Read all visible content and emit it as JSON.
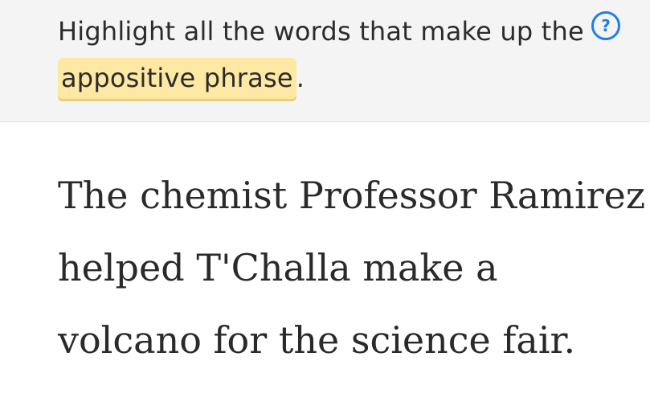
{
  "prompt": {
    "text_before": "Highlight all the words that make up the ",
    "highlighted": "appositive phrase",
    "text_after": "."
  },
  "help_icon": {
    "icon": "question-circle-icon",
    "glyph": "?",
    "color": "#1f7fe6"
  },
  "sentence": {
    "lines": [
      [
        "The",
        "chemist",
        "Professor",
        "Ramirez"
      ],
      [
        "helped",
        "T'Challa",
        "make",
        "a"
      ],
      [
        "volcano",
        "for",
        "the",
        "science",
        "fair."
      ]
    ]
  }
}
